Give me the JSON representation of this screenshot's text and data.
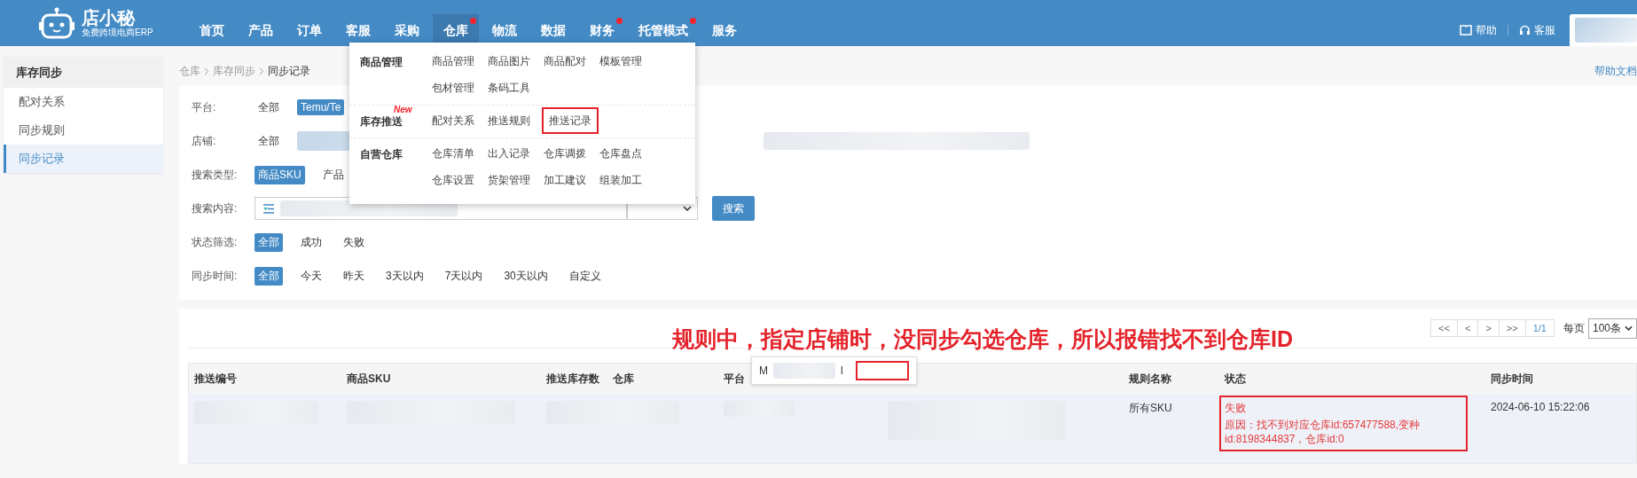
{
  "header": {
    "logo": {
      "name": "店小秘",
      "tagline": "免费跨境电商ERP"
    },
    "nav": [
      {
        "label": "首页",
        "selected": false,
        "dot": false
      },
      {
        "label": "产品",
        "selected": false,
        "dot": false
      },
      {
        "label": "订单",
        "selected": false,
        "dot": false
      },
      {
        "label": "客服",
        "selected": false,
        "dot": false
      },
      {
        "label": "采购",
        "selected": false,
        "dot": false
      },
      {
        "label": "仓库",
        "selected": true,
        "dot": true
      },
      {
        "label": "物流",
        "selected": false,
        "dot": false
      },
      {
        "label": "数据",
        "selected": false,
        "dot": false
      },
      {
        "label": "财务",
        "selected": false,
        "dot": true
      },
      {
        "label": "托管模式",
        "selected": false,
        "dot": true
      },
      {
        "label": "服务",
        "selected": false,
        "dot": false
      }
    ],
    "help": "帮助",
    "support": "客服"
  },
  "sidebar": {
    "title": "库存同步",
    "items": [
      {
        "label": "配对关系",
        "selected": false
      },
      {
        "label": "同步规则",
        "selected": false
      },
      {
        "label": "同步记录",
        "selected": true
      }
    ]
  },
  "breadcrumb": [
    "仓库",
    "库存同步",
    "同步记录"
  ],
  "help_doc": "帮助文档",
  "filters": [
    {
      "kind": "chips",
      "label": "平台:",
      "options": [
        {
          "label": "全部",
          "selected": false
        },
        {
          "label": "Temu/Te",
          "selected": true
        }
      ]
    },
    {
      "kind": "store",
      "label": "店铺:",
      "options": [
        {
          "label": "全部",
          "selected": false
        }
      ]
    },
    {
      "kind": "chips",
      "label": "搜索类型:",
      "options": [
        {
          "label": "商品SKU",
          "selected": true
        },
        {
          "label": "产品",
          "selected": false
        }
      ]
    },
    {
      "kind": "search",
      "label": "搜索内容:",
      "button": "搜索"
    },
    {
      "kind": "chips",
      "label": "状态筛选:",
      "options": [
        {
          "label": "全部",
          "selected": true
        },
        {
          "label": "成功",
          "selected": false
        },
        {
          "label": "失败",
          "selected": false
        }
      ]
    },
    {
      "kind": "chips",
      "label": "同步时间:",
      "options": [
        {
          "label": "全部",
          "selected": true
        },
        {
          "label": "今天",
          "selected": false
        },
        {
          "label": "昨天",
          "selected": false
        },
        {
          "label": "3天以内",
          "selected": false
        },
        {
          "label": "7天以内",
          "selected": false
        },
        {
          "label": "30天以内",
          "selected": false
        },
        {
          "label": "自定义",
          "selected": false
        }
      ]
    }
  ],
  "dropdown": {
    "groups": [
      {
        "title": "商品管理",
        "items": [
          {
            "label": "商品管理",
            "highlighted": false
          },
          {
            "label": "商品图片",
            "highlighted": false
          },
          {
            "label": "商品配对",
            "highlighted": false
          },
          {
            "label": "模板管理",
            "highlighted": false
          },
          {
            "label": "包材管理",
            "highlighted": false
          },
          {
            "label": "条码工具",
            "highlighted": false
          }
        ]
      },
      {
        "title": "库存推送",
        "new_badge": "New",
        "items": [
          {
            "label": "配对关系",
            "highlighted": false
          },
          {
            "label": "推送规则",
            "highlighted": false
          },
          {
            "label": "推送记录",
            "highlighted": true
          }
        ]
      },
      {
        "title": "自营仓库",
        "items": [
          {
            "label": "仓库清单",
            "highlighted": false
          },
          {
            "label": "出入记录",
            "highlighted": false
          },
          {
            "label": "仓库调拨",
            "highlighted": false
          },
          {
            "label": "仓库盘点",
            "highlighted": false
          },
          {
            "label": "仓库设置",
            "highlighted": false
          },
          {
            "label": "货架管理",
            "highlighted": false
          },
          {
            "label": "加工建议",
            "highlighted": false
          },
          {
            "label": "组装加工",
            "highlighted": false
          }
        ]
      }
    ]
  },
  "annotation": "规则中，指定店铺时，没同步勾选仓库，所以报错找不到仓库ID",
  "pagination": {
    "buttons": [
      "<<",
      "<",
      ">",
      ">>"
    ],
    "page": "1/1",
    "per_page_label": "每页",
    "per_page": "100条"
  },
  "table": {
    "columns": [
      "推送编号",
      "商品SKU",
      "推送库存数",
      "仓库",
      "平台",
      "",
      "规则名称",
      "状态",
      "同步时间"
    ],
    "rows": [
      {
        "rule": "所有SKU",
        "status": {
          "kind": "failed",
          "label": "失败",
          "reason": "原因：找不到对应仓库id:657477588,变种id:8198344837，仓库id:0"
        },
        "time": "2024-06-10 15:22:06"
      }
    ]
  },
  "tooltip": {
    "prefix": "M",
    "suffix": "l"
  }
}
